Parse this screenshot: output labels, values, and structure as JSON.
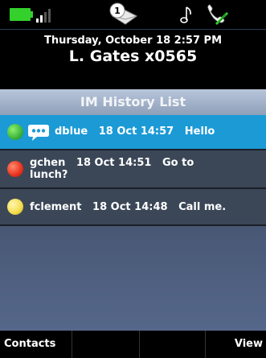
{
  "status_bar": {
    "battery_color": "#34d02c",
    "icons": [
      "battery-icon",
      "signal-strength-icon",
      "message-waiting-icon",
      "ringer-note-icon",
      "handset-status-icon"
    ],
    "message_waiting_count": "1"
  },
  "header": {
    "date_time": "Thursday, October 18 2:57 PM",
    "user_line": "L. Gates x0565"
  },
  "title": "IM History List",
  "rows": [
    {
      "presence_color": "#3cb53c",
      "presence": "available",
      "has_chat_bubble": true,
      "line1": "dblue   18 Oct 14:57   Hello",
      "line2": "",
      "selected": true
    },
    {
      "presence_color": "#e8321e",
      "presence": "busy",
      "has_chat_bubble": false,
      "line1": "gchen   18 Oct 14:51   Go to",
      "line2": "lunch?",
      "selected": false
    },
    {
      "presence_color": "#f4dc4a",
      "presence": "away",
      "has_chat_bubble": false,
      "line1": "fclement   18 Oct 14:48   Call me.",
      "line2": "",
      "selected": false
    }
  ],
  "softkeys": [
    "Contacts",
    "",
    "",
    "View"
  ],
  "colors": {
    "selected_row": "#1b9ad6",
    "title_bar": "#a6b5cc",
    "list_background": "#3b4757"
  }
}
